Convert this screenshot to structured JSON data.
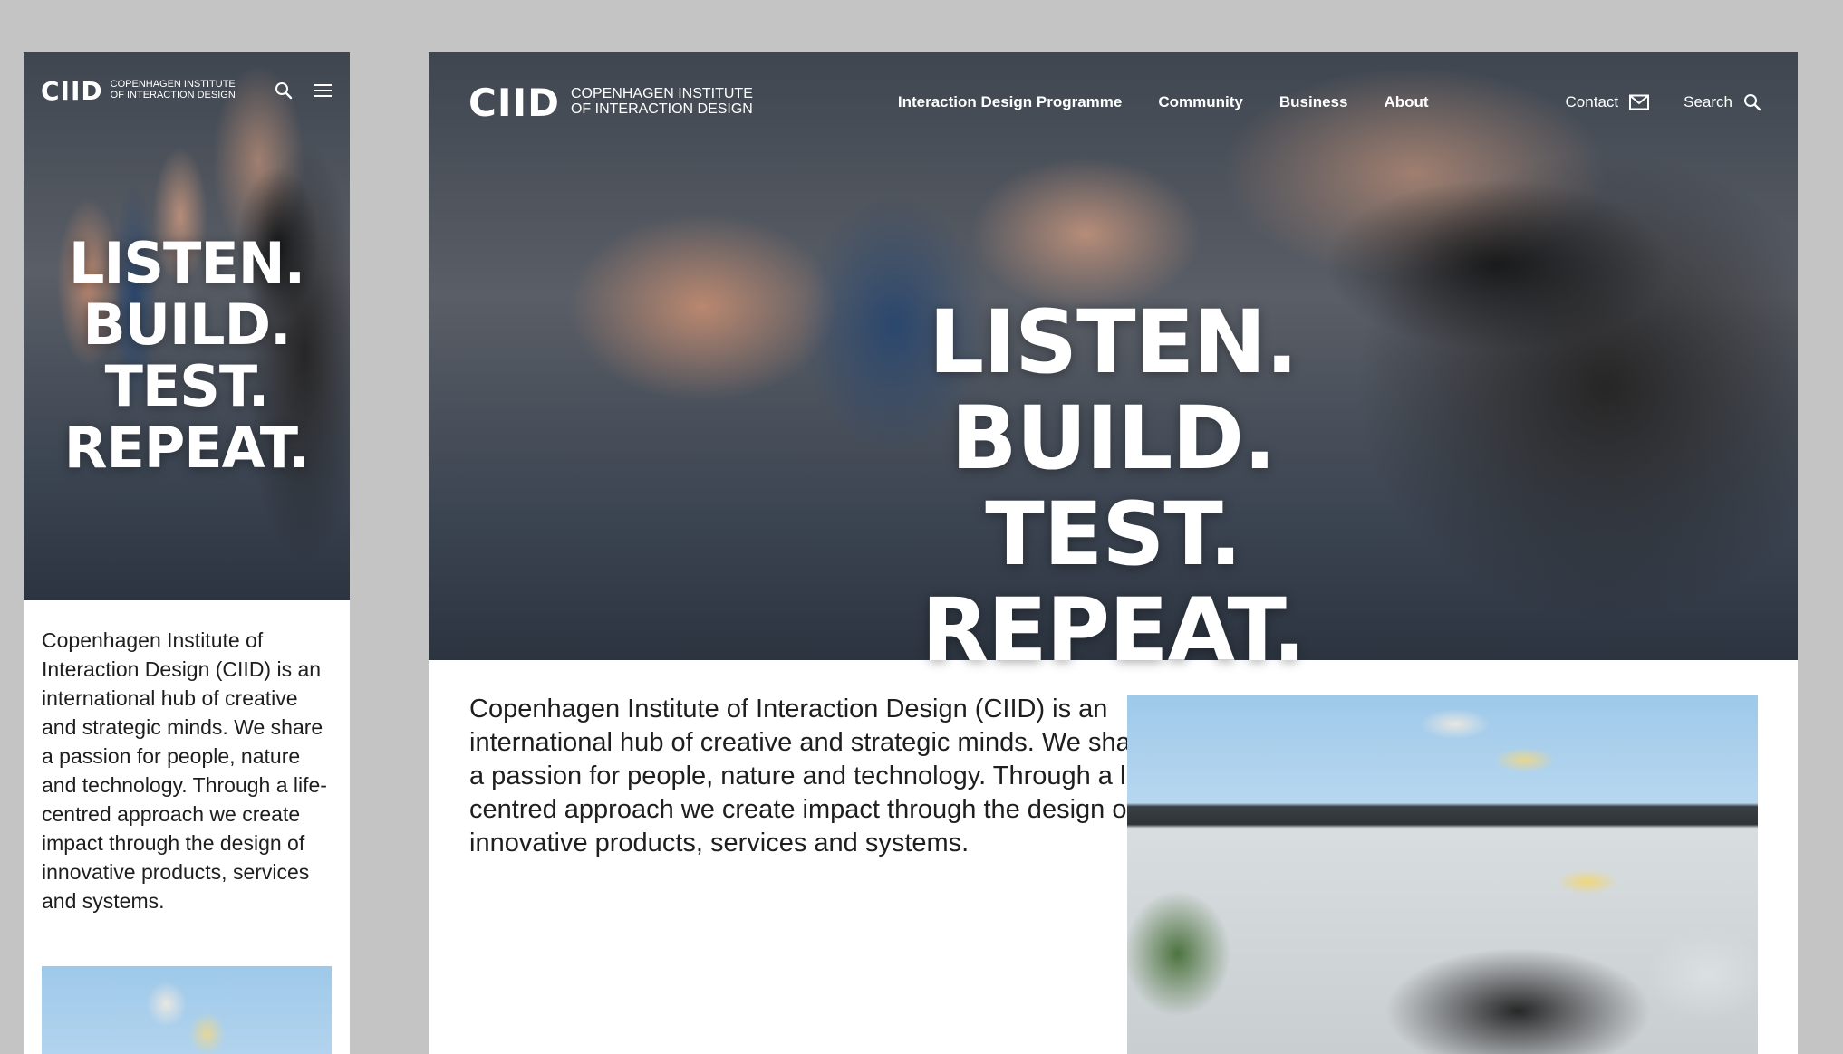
{
  "logo": {
    "mark": "CIID",
    "line1": "COPENHAGEN INSTITUTE",
    "line2": "OF INTERACTION DESIGN"
  },
  "mobile": {
    "hero_title": "LISTEN. BUILD. TEST. REPEAT.",
    "intro": "Copenhagen Institute of Interaction Design (CIID) is an international hub of creative and strategic minds. We share a passion for people, nature and technology. Through a life-centred approach we create impact through the design of innovative products, services and systems.",
    "icons": [
      "search-icon",
      "hamburger-menu-icon"
    ]
  },
  "desktop": {
    "nav": [
      "Interaction Design Programme",
      "Community",
      "Business",
      "About"
    ],
    "utility": {
      "contact": "Contact",
      "search": "Search"
    },
    "hero_title": "LISTEN. BUILD. TEST. REPEAT.",
    "intro": "Copenhagen Institute of Interaction Design (CIID) is an international hub of creative and strategic minds. We share a passion for people, nature and technology. Through a life-centred approach we create impact through the design of innovative products, services and systems.",
    "icons": [
      "envelope-icon",
      "search-icon"
    ]
  },
  "colors": {
    "page_background": "#c4c4c4",
    "frame_background": "#ffffff",
    "hero_text": "#ffffff",
    "body_text": "#1e1e1e"
  }
}
